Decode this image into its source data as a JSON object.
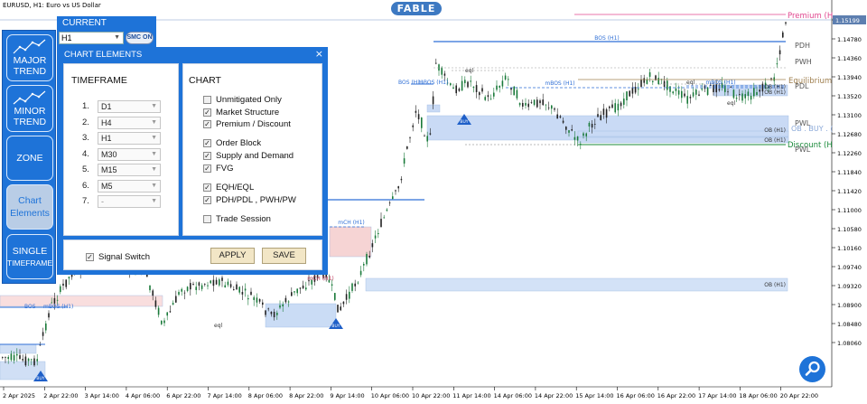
{
  "chart": {
    "symbol": "EURUSD, H1:  Euro vs US Dollar",
    "brand": "FABLE",
    "price_labels": [
      "1.15199",
      "1.14780",
      "1.14360",
      "1.13940",
      "1.13520",
      "1.13100",
      "1.12680",
      "1.12260",
      "1.11840",
      "1.11420",
      "1.11000",
      "1.10580",
      "1.10160",
      "1.09740",
      "1.09320",
      "1.08900",
      "1.08480",
      "1.08060"
    ],
    "current_price": "1.15199",
    "time_labels": [
      "2 Apr 2025",
      "2 Apr 22:00",
      "3 Apr 14:00",
      "4 Apr 06:00",
      "6 Apr 22:00",
      "7 Apr 14:00",
      "8 Apr 06:00",
      "8 Apr 22:00",
      "9 Apr 14:00",
      "10 Apr 06:00",
      "10 Apr 22:00",
      "11 Apr 14:00",
      "14 Apr 06:00",
      "14 Apr 22:00",
      "15 Apr 14:00",
      "16 Apr 06:00",
      "16 Apr 22:00",
      "17 Apr 14:00",
      "18 Apr 06:00",
      "20 Apr 22:00"
    ],
    "labels": {
      "premium": "Premium (H",
      "pdh": "PDH",
      "pwh": "PWH",
      "equilibrium": "Equilibrium",
      "pdl": "PDL",
      "ob_buy": "OB . BUY . (",
      "pwl": "PWL",
      "discount": "Discount (H",
      "bos_top": "BOS (H1)",
      "bos_left": "BOS (H1)",
      "mbos_mid": "mBOS (H1)",
      "mbos_right": "mBOS (H1)",
      "mbos_left": "mBOS (H1)",
      "bos_bottom": "BOS",
      "mbos_bottom": "mBOS (H1)",
      "mch": "mCH (H1)",
      "mch_low": "mCH (H1)",
      "ob_1": "OB (H1)",
      "ob_2": "OB (H1)",
      "ob_3": "OB (H1)",
      "ob_4": "OB (H1)",
      "ob_5": "OB (H1)",
      "eql_1": "eql",
      "eql_2": "eql",
      "eql_3": "eql",
      "eql_4": "eql",
      "buy": "BUY"
    },
    "colors": {
      "bull": "#1a7a3a",
      "bear": "#1a7a3a",
      "ob_blue": "#c9daf5",
      "ob_pink": "#f6d4d4",
      "premium": "#e0468f",
      "discount": "#1a8a3a",
      "equilibrium": "#a08050",
      "bos": "#2f6fd6"
    }
  },
  "sidebar": {
    "items": [
      {
        "label_1": "MAJOR",
        "label_2": "TREND",
        "icon": "trend-icon"
      },
      {
        "label_1": "MINOR",
        "label_2": "TREND",
        "icon": "trend-icon"
      },
      {
        "label_1": "ZONE"
      },
      {
        "label_1": "Chart",
        "label_2": "Elements"
      },
      {
        "label_1": "SINGLE",
        "label_2": "TIMEFRAME"
      }
    ]
  },
  "current": {
    "title": "CURRENT",
    "timeframe": "H1",
    "smc_button": "SMC ON"
  },
  "dialog": {
    "title": "CHART ELEMENTS",
    "timeframe_header": "TIMEFRAME",
    "chart_header": "CHART",
    "timeframes": [
      {
        "num": "1.",
        "value": "D1"
      },
      {
        "num": "2.",
        "value": "H4"
      },
      {
        "num": "3.",
        "value": "H1"
      },
      {
        "num": "4.",
        "value": "M30"
      },
      {
        "num": "5.",
        "value": "M15"
      },
      {
        "num": "6.",
        "value": "M5"
      },
      {
        "num": "7.",
        "value": "-"
      }
    ],
    "options": [
      {
        "label": "Unmitigated Only",
        "checked": false
      },
      {
        "label": "Market Structure",
        "checked": true
      },
      {
        "label": "Premium / Discount",
        "checked": true
      },
      {
        "label": "Order Block",
        "checked": true
      },
      {
        "label": "Supply and Demand",
        "checked": true
      },
      {
        "label": "FVG",
        "checked": true
      },
      {
        "label": "EQH/EQL",
        "checked": true
      },
      {
        "label": "PDH/PDL , PWH/PW",
        "checked": true
      },
      {
        "label": "Trade Session",
        "checked": false
      }
    ],
    "signal_switch": {
      "label": "Signal Switch",
      "checked": true
    },
    "apply": "APPLY",
    "save": "SAVE"
  }
}
